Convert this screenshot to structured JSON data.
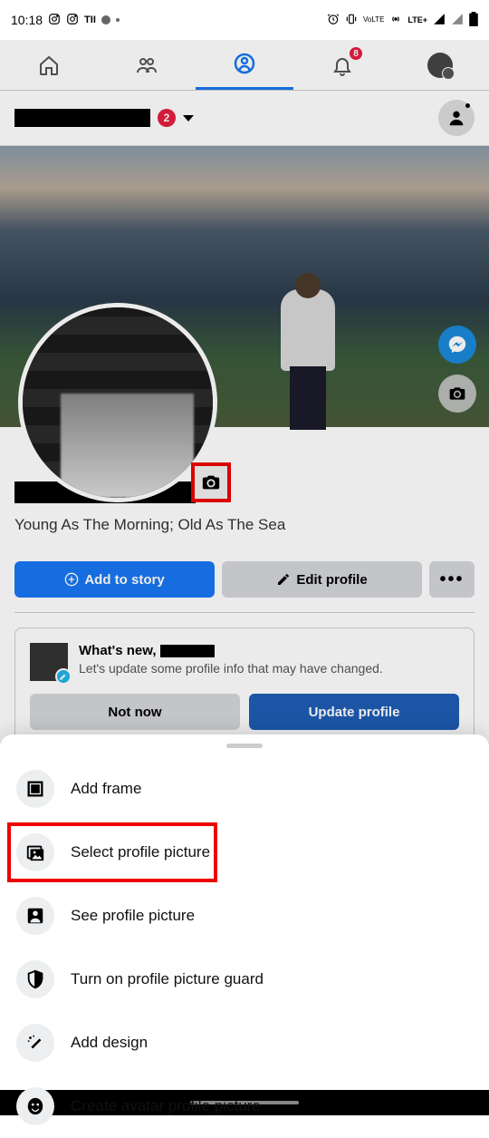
{
  "status": {
    "time": "10:18",
    "tu_label": "TII",
    "lte": "LTE+",
    "volte": "VoLTE"
  },
  "nav": {
    "notification_count": "8"
  },
  "header": {
    "badge": "2"
  },
  "profile": {
    "bio": "Young As The Morning; Old As The Sea"
  },
  "actions": {
    "add_to_story": "Add to story",
    "edit_profile": "Edit profile",
    "more": "•••"
  },
  "update_card": {
    "greeting_prefix": "What's new, ",
    "subtitle": "Let's update some profile info that may have changed.",
    "not_now": "Not now",
    "update": "Update profile"
  },
  "sheet": {
    "items": [
      {
        "icon": "frame",
        "label": "Add frame"
      },
      {
        "icon": "picture",
        "label": "Select profile picture"
      },
      {
        "icon": "person",
        "label": "See profile picture"
      },
      {
        "icon": "shield",
        "label": "Turn on profile picture guard"
      },
      {
        "icon": "design",
        "label": "Add design"
      },
      {
        "icon": "avatar",
        "label": "Create avatar profile picture"
      }
    ]
  }
}
